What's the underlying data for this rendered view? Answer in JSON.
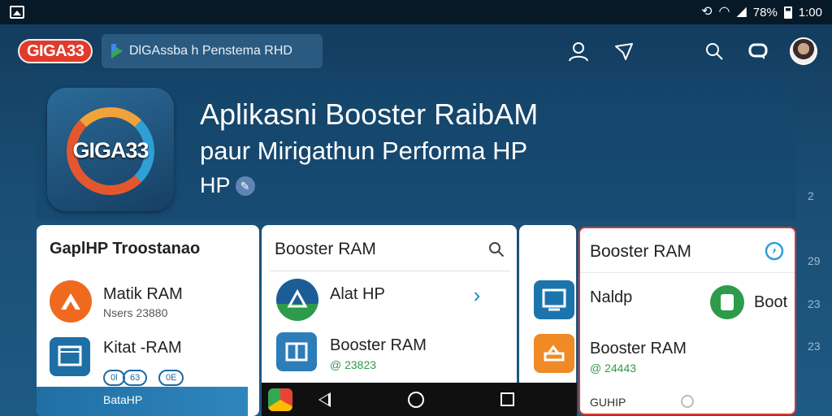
{
  "status": {
    "battery_pct": "78%",
    "time": "1:00"
  },
  "topbar": {
    "brand": "GIGA33",
    "search_text": "DlGAssba h Penstema RHD"
  },
  "hero": {
    "icon_label": "GIGA33",
    "title": "Aplikasni Booster RaibAM",
    "subtitle": "paur Mirigathun Performa HP",
    "subtitle2": "HP"
  },
  "side_marks": [
    "2",
    "29",
    "23",
    "23"
  ],
  "card1": {
    "title": "GaplHP Troostanao",
    "rows": [
      {
        "title": "Matik RAM",
        "sub": "Nsers 23880"
      },
      {
        "title": "Kitat -RAM",
        "pills": [
          "0l",
          "63",
          "0E"
        ]
      }
    ],
    "footer": "BataHP"
  },
  "card2": {
    "title": "Booster RAM",
    "rows": [
      {
        "title": "Alat HP"
      },
      {
        "title": "Booster RAM",
        "sub": "@ 23823"
      }
    ]
  },
  "card4": {
    "title": "Booster RAM",
    "rows": [
      {
        "title": "Naldp",
        "side": "Boot"
      },
      {
        "title": "Booster RAM",
        "sub": "@ 24443"
      }
    ],
    "footer": "GUHIP"
  },
  "colors": {
    "brand": "#e23a2c",
    "highlight_border": "#d63a34",
    "accent_blue": "#2ea0d6"
  }
}
